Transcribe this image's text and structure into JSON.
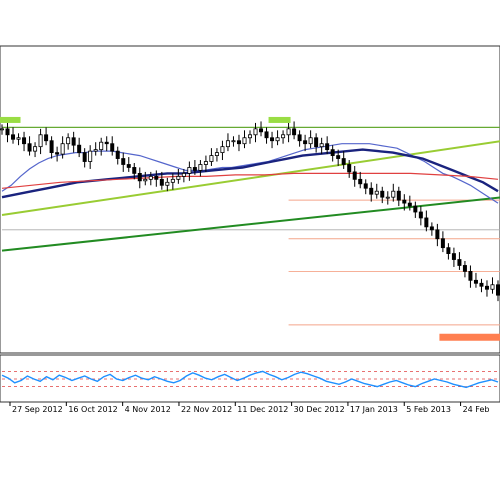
{
  "chart_data": {
    "type": "line",
    "title": "",
    "xlabel": "",
    "ylabel": "",
    "x_tick_labels": [
      "27 Sep 2012",
      "16 Oct 2012",
      "4 Nov 2012",
      "22 Nov 2012",
      "11 Dec 2012",
      "30 Dec 2012",
      "17 Jan 2013",
      "5 Feb 2013",
      "24 Feb"
    ],
    "grid": false,
    "price_panel": {
      "style": "candlestick-bars",
      "ylim": [
        0,
        100
      ],
      "price_closes": [
        90,
        86,
        83,
        84,
        80,
        75,
        78,
        86,
        82,
        74,
        73,
        80,
        84,
        79,
        74,
        68,
        75,
        76,
        81,
        80,
        75,
        70,
        66,
        64,
        60,
        55,
        56,
        58,
        56,
        52,
        54,
        56,
        58,
        60,
        64,
        62,
        66,
        68,
        72,
        74,
        78,
        82,
        82,
        80,
        84,
        86,
        90,
        88,
        84,
        82,
        84,
        86,
        90,
        86,
        82,
        80,
        84,
        78,
        80,
        76,
        72,
        70,
        66,
        61,
        56,
        53,
        50,
        46,
        48,
        44,
        44,
        48,
        42,
        40,
        38,
        34,
        30,
        24,
        22,
        16,
        10,
        6,
        2,
        -2,
        -6,
        -12,
        -14,
        -16,
        -18,
        -15,
        -22
      ],
      "highs_dates_markers": [
        {
          "x_index": 1,
          "level": 96
        },
        {
          "x_index": 50,
          "level": 96
        }
      ],
      "horizontal_levels": [
        {
          "role": "resistance",
          "level": 91,
          "color": "#66aa33",
          "from_index": 0,
          "to_index": 91
        },
        {
          "role": "mid-level",
          "level": 22,
          "color": "#aaaaaa",
          "from_index": 0,
          "to_index": 91
        },
        {
          "role": "fib-level",
          "level": 42,
          "color": "#f4a58a",
          "from_index": 52,
          "to_index": 91
        },
        {
          "role": "fib-level",
          "level": 16,
          "color": "#f4a58a",
          "from_index": 52,
          "to_index": 91
        },
        {
          "role": "fib-level",
          "level": -6,
          "color": "#f4a58a",
          "from_index": 52,
          "to_index": 91
        },
        {
          "role": "fib-level",
          "level": -42,
          "color": "#f4a58a",
          "from_index": 52,
          "to_index": 91
        }
      ],
      "target_zone": {
        "level": -50,
        "from_index": 83,
        "to_index": 91,
        "color": "#ff7f50"
      },
      "trendlines": [
        {
          "role": "uptrend-light",
          "color": "#99cc33",
          "points": [
            [
              0,
              32
            ],
            [
              91,
              82
            ]
          ]
        },
        {
          "role": "uptrend-dark",
          "color": "#228b22",
          "points": [
            [
              0,
              8
            ],
            [
              91,
              44
            ]
          ]
        }
      ],
      "moving_averages": [
        {
          "role": "ma-fast",
          "color": "#5566cc",
          "values": [
            48,
            52,
            58,
            63,
            67,
            70,
            72,
            73,
            74,
            74,
            75,
            75,
            75,
            74,
            73,
            72,
            70,
            68,
            66,
            64,
            62,
            62,
            62,
            63,
            64,
            64,
            65,
            66,
            67,
            68,
            70,
            72,
            74,
            76,
            77,
            78,
            79,
            80,
            80,
            80,
            80,
            79,
            78,
            77,
            74,
            71,
            68,
            64,
            60,
            58,
            55,
            52,
            48,
            44,
            40
          ]
        },
        {
          "role": "ma-slow",
          "color": "#1a237e",
          "values": [
            44,
            46,
            48,
            50,
            52,
            54,
            55,
            56,
            57,
            58,
            59,
            60,
            60,
            61,
            62,
            63,
            64,
            66,
            68,
            70,
            72,
            73,
            74,
            75,
            76,
            75,
            74,
            72,
            70,
            66,
            62,
            58,
            54,
            48
          ]
        },
        {
          "role": "ma-red",
          "color": "#e04040",
          "values": [
            50,
            52,
            54,
            55,
            56,
            57,
            58,
            58,
            59,
            59,
            60,
            60,
            60,
            60,
            60,
            59,
            58,
            56
          ]
        }
      ]
    },
    "oscillator_panel": {
      "type": "line",
      "ylim": [
        0,
        100
      ],
      "levels": [
        70,
        50,
        30
      ],
      "level_color": "#e04040",
      "series_color": "#1e90ff",
      "values": [
        60,
        52,
        40,
        46,
        58,
        50,
        44,
        56,
        48,
        60,
        54,
        46,
        52,
        58,
        50,
        44,
        56,
        62,
        50,
        46,
        54,
        60,
        52,
        48,
        56,
        50,
        44,
        40,
        46,
        58,
        66,
        60,
        52,
        48,
        56,
        62,
        54,
        46,
        52,
        60,
        66,
        70,
        62,
        56,
        48,
        54,
        62,
        68,
        64,
        58,
        52,
        44,
        40,
        36,
        42,
        50,
        44,
        38,
        34,
        30,
        36,
        42,
        46,
        40,
        34,
        30,
        38,
        44,
        50,
        46,
        42,
        36,
        32,
        28,
        34,
        40,
        44,
        48,
        42
      ]
    }
  }
}
